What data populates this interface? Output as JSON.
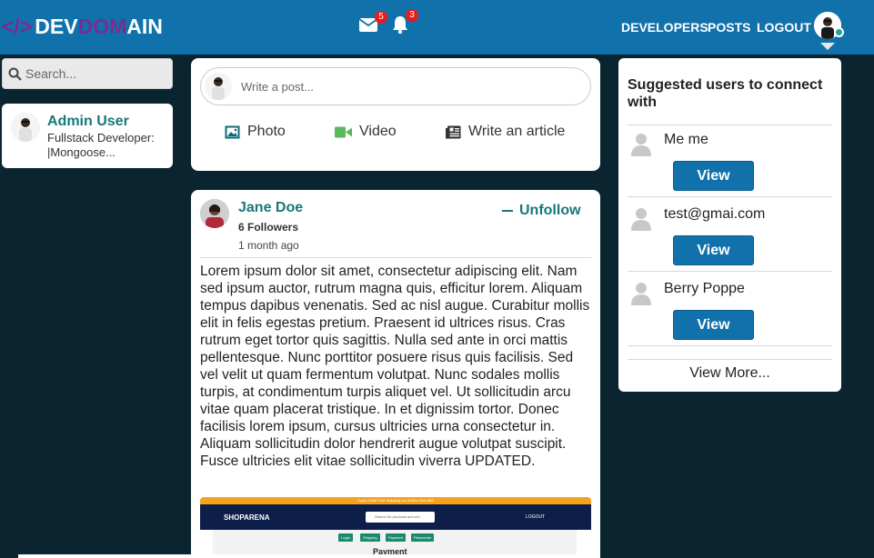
{
  "header": {
    "logo_prefix": "</>",
    "logo_part1": "DEV",
    "logo_part2": "DOM",
    "logo_part3": "AIN",
    "messages_count": "5",
    "notifications_count": "3",
    "nav": [
      "DEVELOPERS",
      "POSTS",
      "LOGOUT"
    ],
    "colors": {
      "bar": "#1172ab",
      "logo_accent": "#7b2b92",
      "badge": "#e81b1b"
    }
  },
  "sidebar_left": {
    "search_placeholder": "Search...",
    "profile": {
      "name": "Admin User",
      "bio": "Fullstack Developer: |Mongoose..."
    }
  },
  "composer": {
    "placeholder": "Write a post...",
    "actions": [
      "Photo",
      "Video",
      "Write an article"
    ]
  },
  "post": {
    "author": "Jane Doe",
    "followers": "6 Followers",
    "time": "1 month ago",
    "unfollow_label": "Unfollow",
    "body": "Lorem ipsum dolor sit amet, consectetur adipiscing elit. Nam sed ipsum auctor, rutrum magna quis, efficitur lorem. Aliquam tempus dapibus venenatis. Sed ac nisl augue. Curabitur mollis elit in felis egestas pretium. Praesent id ultrices risus. Cras rutrum eget tortor quis sagittis. Nulla sed ante in orci mattis pellentesque. Nunc porttitor posuere risus quis facilisis. Sed vel velit ut quam fermentum volutpat. Nunc sodales mollis turpis, at condimentum turpis aliquet vel. Ut sollicitudin arcu vitae quam placerat tristique. In et dignissim tortor. Donec facilisis lorem ipsum, cursus ultricies urna consectetur in. Aliquam sollicitudin dolor hendrerit augue volutpat suscipit. Fusce ultricies elit vitae sollicitudin viverra UPDATED.",
    "image": {
      "banner": "Super Deal! Free Shipping on Orders Over $50",
      "brand": "SHOPARENA",
      "search_placeholder": "Search for products and ord",
      "logout": "LOGOUT",
      "buttons": [
        "Login",
        "Shipping",
        "Payment",
        "Placeorder"
      ],
      "title": "Payment"
    }
  },
  "suggestions": {
    "title": "Suggested users to connect with",
    "users": [
      {
        "name": "Me me",
        "button": "View"
      },
      {
        "name": "test@gmai.com",
        "button": "View"
      },
      {
        "name": "Berry Poppe",
        "button": "View"
      }
    ],
    "more": "View More..."
  }
}
